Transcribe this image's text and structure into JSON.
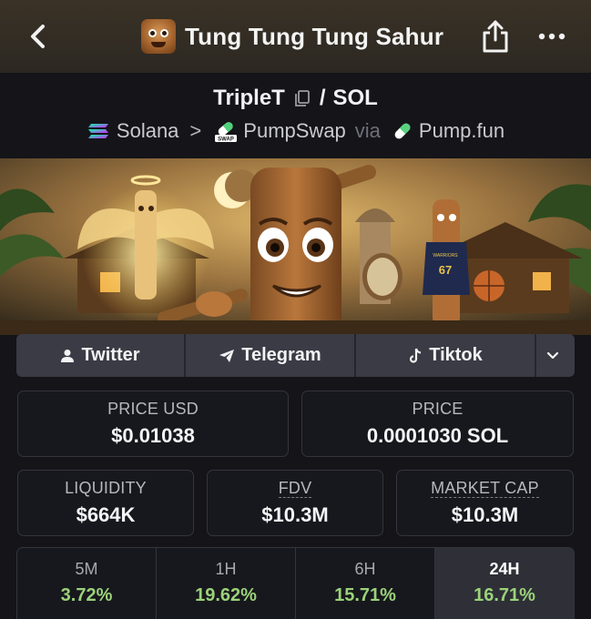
{
  "header": {
    "title": "Tung Tung Tung Sahur",
    "back_icon": "chevron-left-icon",
    "share_icon": "share-icon",
    "more_icon": "more-horizontal-icon"
  },
  "pair": {
    "base": "TripleT",
    "separator": "/",
    "quote": "SOL",
    "copy_icon": "copy-icon"
  },
  "route": {
    "chain": "Solana",
    "arrow": ">",
    "dex": "PumpSwap",
    "via": "via",
    "launchpad": "Pump.fun",
    "dex_icon_label": "SWAP"
  },
  "social": {
    "twitter": "Twitter",
    "telegram": "Telegram",
    "tiktok": "Tiktok"
  },
  "stats": {
    "price_usd_label": "PRICE USD",
    "price_usd": "$0.01038",
    "price_label": "PRICE",
    "price": "0.0001030 SOL",
    "liquidity_label": "LIQUIDITY",
    "liquidity": "$664K",
    "fdv_label": "FDV",
    "fdv": "$10.3M",
    "mcap_label": "MARKET CAP",
    "mcap": "$10.3M"
  },
  "timeframes": [
    {
      "label": "5M",
      "change": "3.72%"
    },
    {
      "label": "1H",
      "change": "19.62%"
    },
    {
      "label": "6H",
      "change": "15.71%"
    },
    {
      "label": "24H",
      "change": "16.71%"
    }
  ],
  "active_timeframe": "24H",
  "banner": {
    "jersey_number": "67",
    "jersey_text": "WARRIORS"
  },
  "colors": {
    "background": "#141419",
    "positive": "#9bd27a",
    "panel": "#3a3b44"
  }
}
